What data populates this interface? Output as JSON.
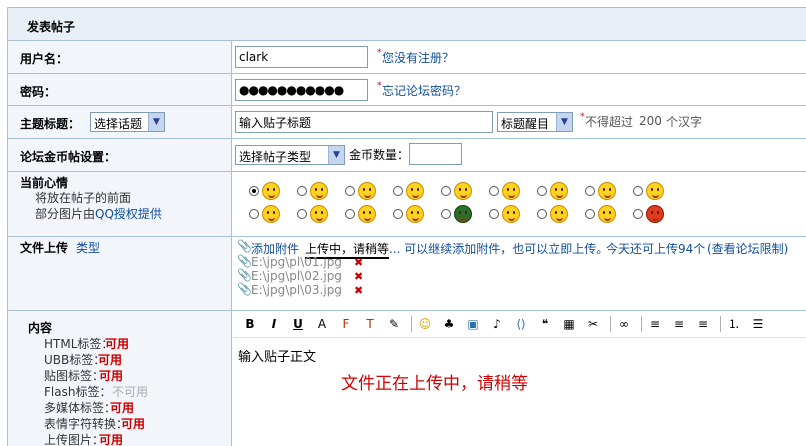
{
  "form_title": "发表帖子",
  "username": {
    "label": "用户名：",
    "value": "clark",
    "link": "您没有注册？"
  },
  "password": {
    "label": "密码：",
    "value": "●●●●●●●●●●●",
    "link": "忘记论坛密码？"
  },
  "subject": {
    "label": "主题标题：",
    "topic_select": "选择话题",
    "placeholder_value": "输入贴子标题",
    "style_select": "标题醒目",
    "hint": "不得超过",
    "max": "200",
    "hint2": "个汉字"
  },
  "gold": {
    "label": "论坛金币帖设置：",
    "type_select": "选择帖子类型",
    "amount_label": "金币数量："
  },
  "mood": {
    "label": "当前心情",
    "line1": "将放在帖子的前面",
    "line2_prefix": "部分图片由",
    "line2_link": "QQ授权提供",
    "selected_index": 0
  },
  "upload": {
    "label": "文件上传",
    "type_link": "类型",
    "add_attachment": "添加附件",
    "uploading": "上传中，请稍等",
    "continue_text": "... 可以继续添加附件，也可以立即上传。",
    "quota_text": "今天还可上传94个",
    "limit_link": "(查看论坛限制)",
    "files": [
      "E:\\jpg\\pl\\01.jpg",
      "E:\\jpg\\pl\\02.jpg",
      "E:\\jpg\\pl\\03.jpg"
    ]
  },
  "content": {
    "label": "内容",
    "tags": [
      {
        "name": "HTML标签：",
        "status": "可用",
        "enabled": true
      },
      {
        "name": "UBB标签：",
        "status": "可用",
        "enabled": true
      },
      {
        "name": "贴图标签：",
        "status": "可用",
        "enabled": true
      },
      {
        "name": "Flash标签：",
        "status": "不可用",
        "enabled": false
      },
      {
        "name": "多媒体标签：",
        "status": "可用",
        "enabled": true
      },
      {
        "name": "表情字符转换：",
        "status": "可用",
        "enabled": true
      },
      {
        "name": "上传图片：",
        "status": "可用",
        "enabled": true
      }
    ],
    "editor_text": "输入贴子正文",
    "overlay": "文件正在上传中，请稍等",
    "toolbar": [
      "bold-icon",
      "italic-icon",
      "underline-icon",
      "font-size-icon",
      "font-face-icon",
      "font-color-icon",
      "highlight-icon",
      "smiley-icon",
      "mascot-icon",
      "image-icon",
      "music-icon",
      "code-icon",
      "quote-icon",
      "table-icon",
      "clean-icon",
      "link-icon",
      "align-left-icon",
      "align-center-icon",
      "align-right-icon",
      "ordered-list-icon",
      "unordered-list-icon"
    ]
  },
  "colors": {
    "label_bg": "#f2f6fb",
    "border": "#a8bfd9",
    "link": "#104e9b",
    "red": "#d00000"
  }
}
